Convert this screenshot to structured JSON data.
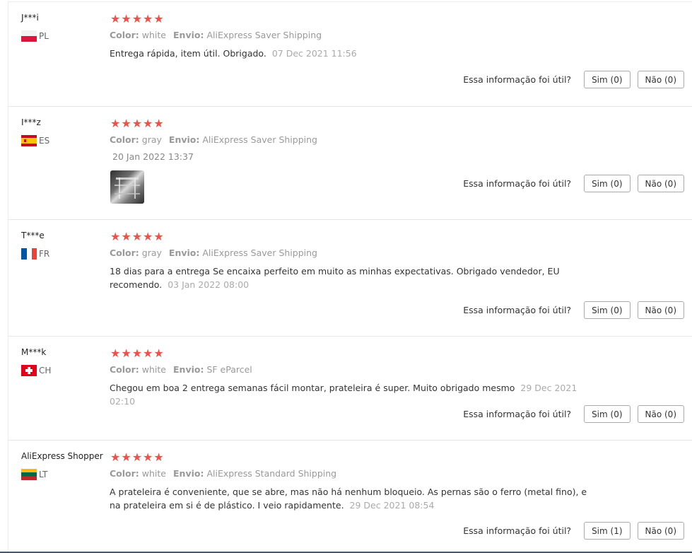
{
  "helpful_question": "Essa informação foi útil?",
  "color_label": "Color:",
  "shipping_label": "Envio:",
  "reviews": [
    {
      "user": "J***i",
      "country": "PL",
      "flag": "pl-flag-icon",
      "stars": "★★★★★",
      "color": "white",
      "shipping": "AliExpress Saver Shipping",
      "text": "Entrega rápida, item útil. Obrigado.",
      "date": "07 Dec 2021 11:56",
      "yes": "Sim (0)",
      "no": "Não (0)"
    },
    {
      "user": "I***z",
      "country": "ES",
      "flag": "es-flag-icon",
      "stars": "★★★★★",
      "color": "gray",
      "shipping": "AliExpress Saver Shipping",
      "text": "",
      "date": "20 Jan 2022 13:37",
      "image": "review-photo",
      "yes": "Sim (0)",
      "no": "Não (0)"
    },
    {
      "user": "T***e",
      "country": "FR",
      "flag": "fr-flag-icon",
      "stars": "★★★★★",
      "color": "gray",
      "shipping": "AliExpress Saver Shipping",
      "text": "18 dias para a entrega Se encaixa perfeito em muito as minhas expectativas. Obrigado vendedor, EU recomendo.",
      "date": "03 Jan 2022 08:00",
      "yes": "Sim (0)",
      "no": "Não (0)"
    },
    {
      "user": "M***k",
      "country": "CH",
      "flag": "ch-flag-icon",
      "stars": "★★★★★",
      "color": "white",
      "shipping": "SF eParcel",
      "text": "Chegou em boa 2 entrega semanas fácil montar, prateleira é super. Muito obrigado mesmo",
      "date": "29 Dec 2021 02:10",
      "yes": "Sim (0)",
      "no": "Não (0)"
    },
    {
      "user": "AliExpress Shopper",
      "country": "LT",
      "flag": "lt-flag-icon",
      "stars": "★★★★★",
      "color": "white",
      "shipping": "AliExpress Standard Shipping",
      "text": "A prateleira é conveniente, que se abre, mas não há nenhum bloqueio. As pernas são o ferro (metal fino), e na prateleira em si é de plástico. I veio rapidamente.",
      "date": "29 Dec 2021 08:54",
      "yes": "Sim (1)",
      "no": "Não (0)"
    }
  ],
  "colors": {
    "star": "#f0504a",
    "meta": "#999999",
    "date": "#aaaaaa",
    "border": "#e8e8e8"
  }
}
